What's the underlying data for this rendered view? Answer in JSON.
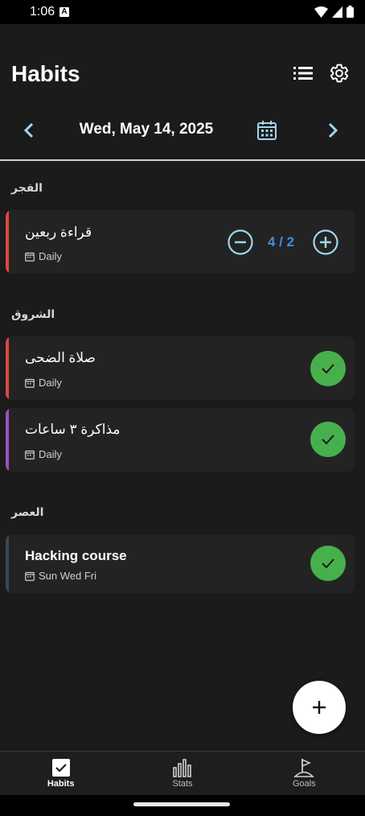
{
  "status_bar": {
    "time": "1:06",
    "notification_letter": "A"
  },
  "header": {
    "title": "Habits"
  },
  "date_nav": {
    "date": "Wed, May 14, 2025"
  },
  "sections": [
    {
      "label": "الفجر"
    },
    {
      "label": "الشروق"
    },
    {
      "label": "العصر"
    }
  ],
  "habits": [
    {
      "title": "قراءة ربعين",
      "schedule": "Daily",
      "accent": "#e0463a",
      "progress": "4 / 2",
      "done": false
    },
    {
      "title": "صلاة الضحى",
      "schedule": "Daily",
      "accent": "#e0463a",
      "done": true
    },
    {
      "title": "مذاكرة ٣ ساعات",
      "schedule": "Daily",
      "accent": "#9c4fc0",
      "done": true
    },
    {
      "title": "Hacking course",
      "schedule": "Sun Wed Fri",
      "accent": "#3a4658",
      "done": true
    }
  ],
  "colors": {
    "accent_blue": "#3f8ee0",
    "check_green": "#47b04d",
    "icon_cyan": "#9fd7ee"
  },
  "bottom_nav": {
    "habits": "Habits",
    "stats": "Stats",
    "goals": "Goals"
  }
}
